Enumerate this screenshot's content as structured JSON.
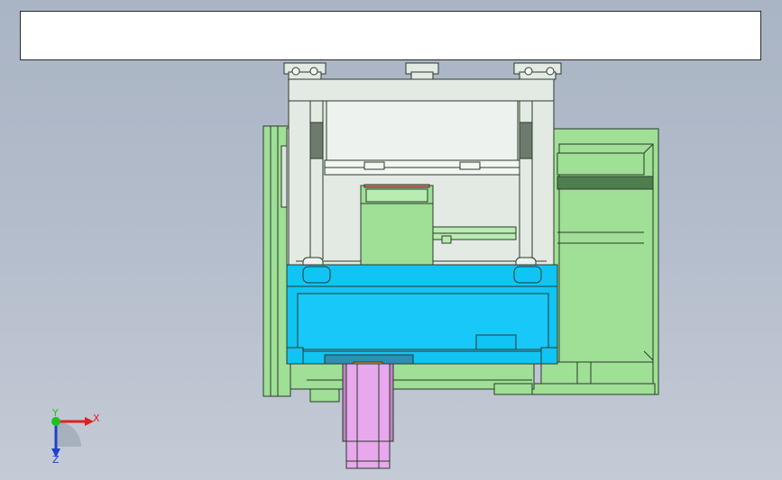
{
  "window": {
    "title_banner_text": ""
  },
  "triad": {
    "x_label": "X",
    "y_label": "Y",
    "z_label": "Z",
    "x_color": "#e02020",
    "y_color": "#20c020",
    "z_color": "#2040d0"
  },
  "colors": {
    "frame_green": "#9fdf96",
    "dark_green": "#4f7e4d",
    "table_cyan": "#10c4f4",
    "column_white": "#e3e9e3",
    "ram_magenta": "#e8a8ec",
    "nut_orange": "#f2a030",
    "outline": "#2b3a2b"
  },
  "icons": [
    "coordinate-triad-icon"
  ]
}
